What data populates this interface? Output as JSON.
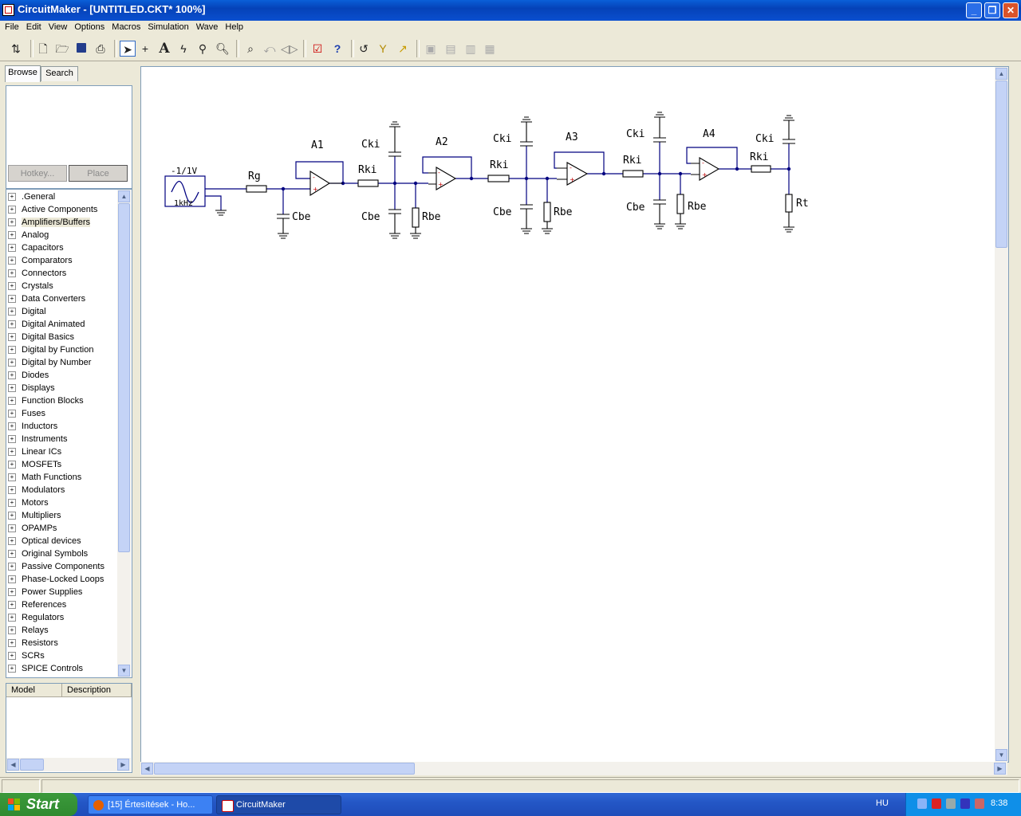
{
  "window": {
    "title": "CircuitMaker - [UNTITLED.CKT* 100%]"
  },
  "menu": [
    "File",
    "Edit",
    "View",
    "Options",
    "Macros",
    "Simulation",
    "Wave",
    "Help"
  ],
  "toolbar": {
    "icons": [
      "flip-icon",
      "new-file-icon",
      "open-folder-icon",
      "save-icon",
      "print-icon",
      "arrow-select-icon",
      "wire-cross-icon",
      "text-tool-icon",
      "probe-lightning-icon",
      "wand-icon",
      "zoom-icon",
      "search-part-icon",
      "undo-rotate-icon",
      "mirror-icon",
      "checklist-icon",
      "help-question-icon",
      "reset-icon",
      "step-icon",
      "run-icon",
      "disabled-1-icon",
      "disabled-2-icon",
      "disabled-3-icon",
      "disabled-4-icon"
    ]
  },
  "left_panel": {
    "tabs": [
      "Browse",
      "Search"
    ],
    "hotkey_label": "Hotkey...",
    "place_label": "Place",
    "categories": [
      ".General",
      "Active Components",
      "Amplifiers/Buffers",
      "Analog",
      "Capacitors",
      "Comparators",
      "Connectors",
      "Crystals",
      "Data Converters",
      "Digital",
      "Digital Animated",
      "Digital Basics",
      "Digital by Function",
      "Digital by Number",
      "Diodes",
      "Displays",
      "Function Blocks",
      "Fuses",
      "Inductors",
      "Instruments",
      "Linear ICs",
      "MOSFETs",
      "Math Functions",
      "Modulators",
      "Motors",
      "Multipliers",
      "OPAMPs",
      "Optical devices",
      "Original Symbols",
      "Passive Components",
      "Phase-Locked Loops",
      "Power Supplies",
      "References",
      "Regulators",
      "Relays",
      "Resistors",
      "SCRs",
      "SPICE Controls"
    ],
    "selected_category": "Amplifiers/Buffers",
    "model_headers": [
      "Model",
      "Description"
    ]
  },
  "schematic": {
    "source_amplitude": "-1/1V",
    "source_freq": "1kHz",
    "labels": {
      "rg": "Rg",
      "cbe": "Cbe",
      "a1": "A1",
      "a2": "A2",
      "a3": "A3",
      "a4": "A4",
      "cki": "Cki",
      "rki": "Rki",
      "rbe": "Rbe",
      "rt": "Rt"
    }
  },
  "taskbar": {
    "start_label": "Start",
    "tasks": [
      "[15] Értesítések - Ho...",
      "CircuitMaker"
    ],
    "language": "HU",
    "clock": "8:38"
  },
  "colors": {
    "titlebar": "#0542b8",
    "taskbar": "#245edb",
    "start": "#3c9a3c",
    "tray": "#0f8fe8",
    "wire": "#000080",
    "part": "#000000"
  }
}
